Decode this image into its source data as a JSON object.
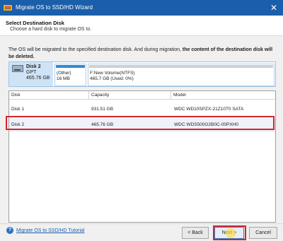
{
  "titlebar": {
    "title": "Migrate OS to SSD/HD Wizard",
    "close_glyph": "✕",
    "icon": "wizard-app-icon"
  },
  "header": {
    "title": "Select Destination Disk",
    "subtitle": "Choose a hard disk to migrate OS to."
  },
  "notice": {
    "text": "The OS will be migrated to the specified destination disk. And during migration, ",
    "bold_text": "the content of the destination disk will be deleted."
  },
  "disk_map": {
    "name": "Disk 2",
    "style": "GPT",
    "size": "465.76 GB",
    "partitions": [
      {
        "label": "(Other)",
        "meta": "16 MB"
      },
      {
        "label": "F:New Volume(NTFS)",
        "meta": "465.7 GB (Used: 0%)"
      }
    ]
  },
  "table": {
    "columns": [
      "Disk",
      "Capacity",
      "Model"
    ],
    "rows": [
      {
        "disk": "Disk 1",
        "capacity": "931.51 GB",
        "model": "WDC WD10SPZX-21Z10T0 SATA"
      },
      {
        "disk": "Disk 2",
        "capacity": "465.76 GB",
        "model": "WDC WDS500G2B0C-00PXH0"
      }
    ],
    "selected_index": 1
  },
  "footer": {
    "help_glyph": "?",
    "help_link": "Migrate OS to SSD/HD Tutorial",
    "back_label": "< Back",
    "next_label": "Next >",
    "cancel_label": "Cancel"
  },
  "colors": {
    "titlebar": "#1b5fab",
    "highlight": "#d8232a",
    "accent": "#2e8bd6"
  }
}
